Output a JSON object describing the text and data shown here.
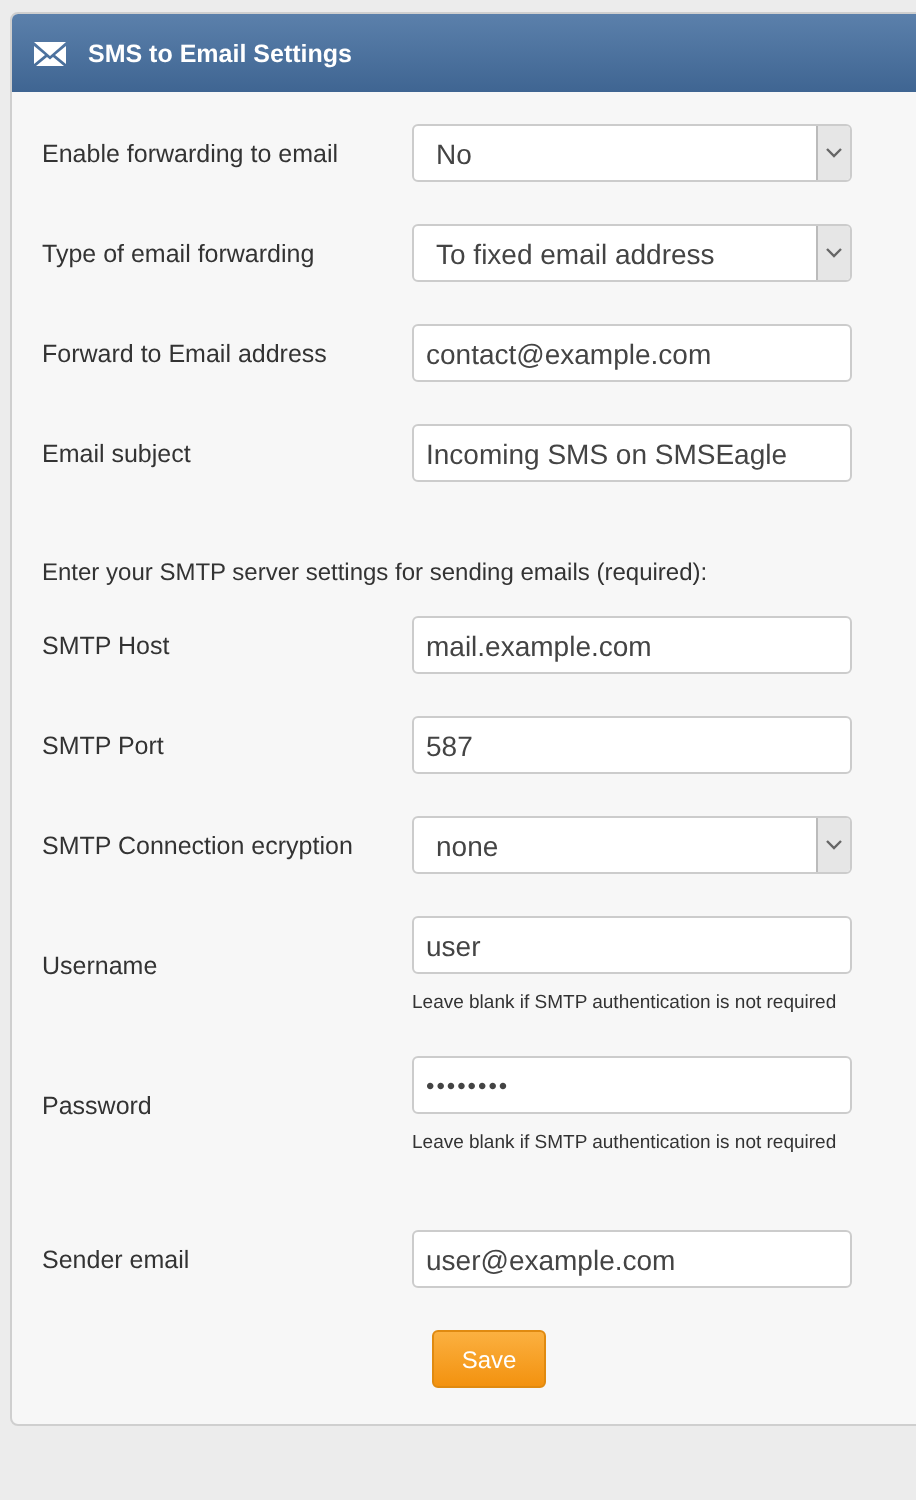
{
  "panel": {
    "title": "SMS to Email Settings"
  },
  "sections": [
    {
      "rows": [
        {
          "kind": "select",
          "label": "Enable forwarding to email",
          "value": "No"
        },
        {
          "kind": "select",
          "label": "Type of email forwarding",
          "value": "To fixed email address"
        },
        {
          "kind": "text",
          "label": "Forward to Email address",
          "value": "contact@example.com"
        },
        {
          "kind": "text",
          "label": "Email subject",
          "value": "Incoming SMS on SMSEagle"
        }
      ]
    },
    {
      "intro": "Enter your SMTP server settings for sending emails (required):",
      "rows": [
        {
          "kind": "text",
          "label": "SMTP Host",
          "value": "mail.example.com"
        },
        {
          "kind": "text",
          "label": "SMTP Port",
          "value": "587"
        },
        {
          "kind": "select",
          "label": "SMTP Connection ecryption",
          "value": "none"
        },
        {
          "kind": "text",
          "label": "Username",
          "value": "user",
          "hint": "Leave blank if SMTP authentication is not required"
        },
        {
          "kind": "password",
          "label": "Password",
          "value": "••••••••",
          "hint": "Leave blank if SMTP authentication is not required"
        }
      ]
    },
    {
      "rows": [
        {
          "kind": "text",
          "label": "Sender email",
          "value": "user@example.com"
        }
      ]
    }
  ],
  "save_button": "Save"
}
